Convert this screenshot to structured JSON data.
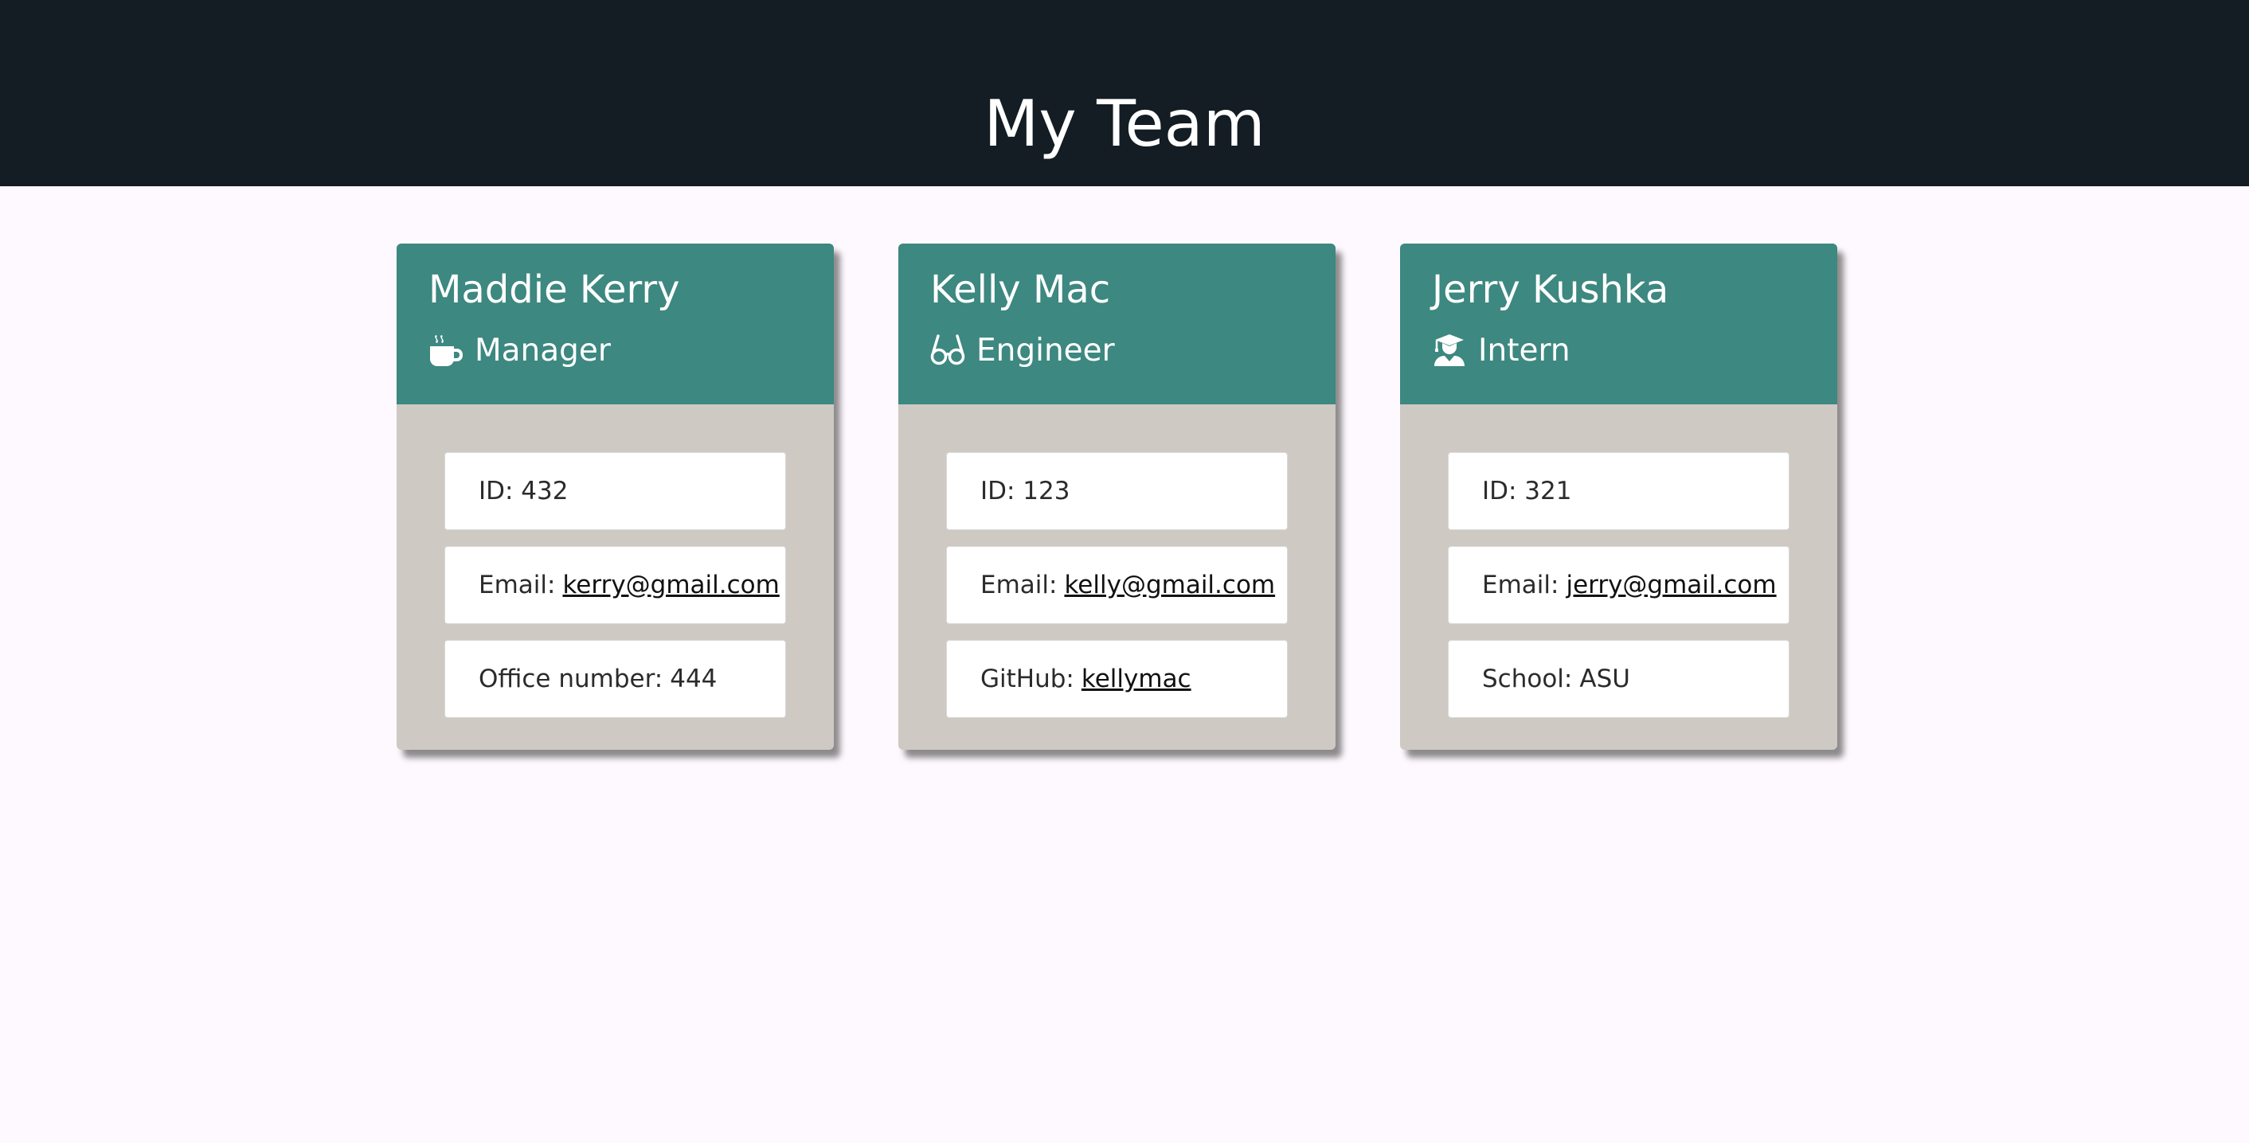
{
  "header": {
    "title": "My Team"
  },
  "employees": [
    {
      "name": "Maddie Kerry",
      "role": "Manager",
      "role_icon": "coffee-icon",
      "id": "ID: 432",
      "email_label": "Email:",
      "email": "kerry@gmail.com",
      "extra_label": "Office number:",
      "extra_value": "444"
    },
    {
      "name": "Kelly Mac",
      "role": "Engineer",
      "role_icon": "glasses-icon",
      "id": "ID: 123",
      "email_label": "Email:",
      "email": "kelly@gmail.com",
      "extra_label": "GitHub:",
      "extra_value": "kellymac"
    },
    {
      "name": "Jerry Kushka",
      "role": "Intern",
      "role_icon": "graduate-icon",
      "id": "ID: 321",
      "email_label": "Email:",
      "email": "jerry@gmail.com",
      "extra_label": "School:",
      "extra_value": "ASU"
    }
  ],
  "colors": {
    "header_bg": "#131d23",
    "page_bg": "#fef9fe",
    "card_head_bg": "#3d8880",
    "card_body_bg": "#cec9c3"
  }
}
